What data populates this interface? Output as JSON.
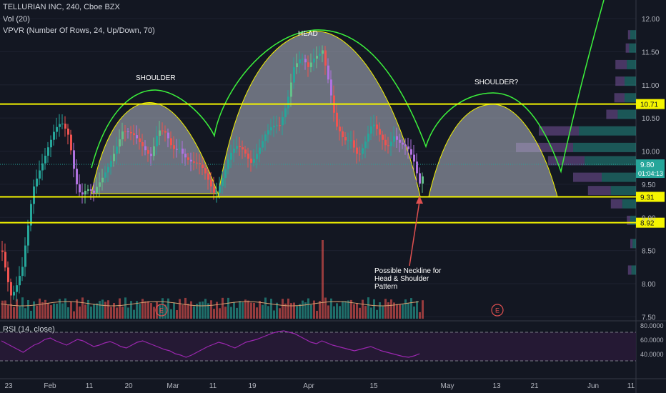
{
  "header": {
    "title": "TELLURIAN INC, 240, Cboe BZX",
    "vol": "Vol (20)",
    "vpvr": "VPVR (Number Of Rows, 24, Up/Down, 70)"
  },
  "rsi_label": "RSI (14, close)",
  "colors": {
    "background": "#131722",
    "up": "#26a69a",
    "down": "#ef5350",
    "purple": "#b072e0",
    "yellow": "#f5f500",
    "green_outline": "#3cf23c",
    "hump_fill": "#b4b9c8",
    "rsi_line": "#9c27b0",
    "rsi_band": "#2a1a3a"
  },
  "chart_data": {
    "type": "candlestick",
    "title": "TELLURIAN INC, 240, Cboe BZX",
    "y_axis": {
      "min": 7.5,
      "max": 12.2,
      "ticks": [
        "12.00",
        "11.50",
        "11.00",
        "10.50",
        "10.00",
        "9.50",
        "9.00",
        "8.50",
        "8.00",
        "7.50"
      ]
    },
    "x_axis_labels": [
      "23",
      "Feb",
      "11",
      "20",
      "Mar",
      "11",
      "19",
      "Apr",
      "15",
      "May",
      "13",
      "21",
      "Jun",
      "11"
    ],
    "price_lines": [
      {
        "value": 10.71,
        "label": "10.71"
      },
      {
        "value": 9.31,
        "label": "9.31"
      },
      {
        "value": 8.92,
        "label": "8.92"
      }
    ],
    "current_price": {
      "value": 9.8,
      "label": "9.80",
      "countdown": "01:04:13"
    },
    "annotations": {
      "left_shoulder": "SHOULDER",
      "head": "HEAD",
      "right_shoulder": "SHOULDER?",
      "neckline_note": [
        "Possible Neckline for",
        "Head & Shoulder",
        "Pattern"
      ]
    },
    "earnings_marker": "E",
    "rsi": {
      "label": "RSI (14, close)",
      "ticks": [
        "80.0000",
        "60.0000",
        "40.0000"
      ],
      "upper": 70,
      "lower": 30,
      "values": [
        58,
        54,
        50,
        46,
        42,
        47,
        52,
        55,
        60,
        62,
        58,
        55,
        52,
        56,
        60,
        58,
        54,
        50,
        52,
        55,
        57,
        54,
        50,
        48,
        52,
        56,
        58,
        55,
        52,
        49,
        46,
        44,
        40,
        38,
        35,
        38,
        42,
        46,
        50,
        53,
        56,
        54,
        51,
        48,
        52,
        56,
        58,
        60,
        63,
        66,
        69,
        71,
        72,
        70,
        68,
        64,
        60,
        56,
        54,
        58,
        55,
        52,
        50,
        48,
        46,
        44,
        46,
        48,
        50,
        47,
        44,
        42,
        40,
        38,
        36,
        35,
        37,
        40
      ]
    },
    "vpvr_rows": [
      {
        "price": 11.75,
        "up": 0.05,
        "down": 0.02
      },
      {
        "price": 11.55,
        "up": 0.06,
        "down": 0.03
      },
      {
        "price": 11.3,
        "up": 0.08,
        "down": 0.1
      },
      {
        "price": 11.05,
        "up": 0.1,
        "down": 0.08
      },
      {
        "price": 10.8,
        "up": 0.1,
        "down": 0.09
      },
      {
        "price": 10.55,
        "up": 0.16,
        "down": 0.1
      },
      {
        "price": 10.3,
        "up": 0.5,
        "down": 0.35
      },
      {
        "price": 10.05,
        "up": 0.55,
        "down": 0.5
      },
      {
        "price": 9.85,
        "up": 0.45,
        "down": 0.32
      },
      {
        "price": 9.6,
        "up": 0.3,
        "down": 0.25
      },
      {
        "price": 9.4,
        "up": 0.22,
        "down": 0.2
      },
      {
        "price": 9.2,
        "up": 0.12,
        "down": 0.1
      },
      {
        "price": 8.95,
        "up": 0.05,
        "down": 0.03
      },
      {
        "price": 8.6,
        "up": 0.03,
        "down": 0.02
      },
      {
        "price": 8.2,
        "up": 0.04,
        "down": 0.03
      }
    ]
  }
}
